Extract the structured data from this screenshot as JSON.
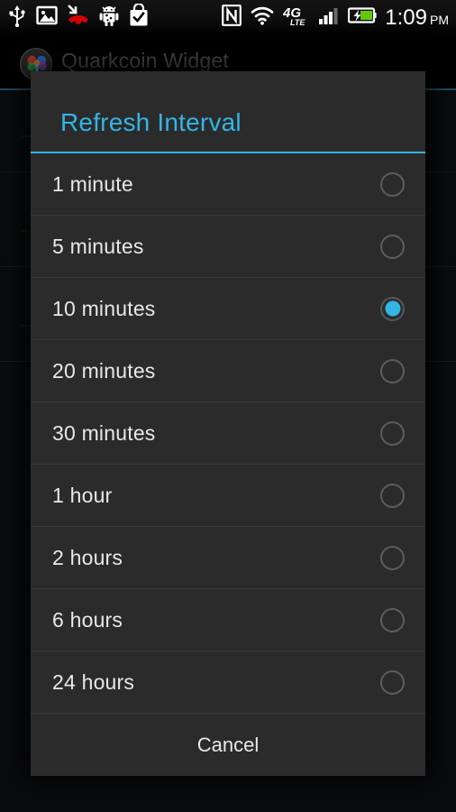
{
  "status_bar": {
    "time": "1:09",
    "am_pm": "PM",
    "left_icons": [
      {
        "name": "usb-icon",
        "label": "USB connected"
      },
      {
        "name": "screenshot-image-icon",
        "label": "Screenshot captured"
      },
      {
        "name": "missed-call-icon",
        "label": "Missed call"
      },
      {
        "name": "android-debug-icon",
        "label": "USB debugging connected"
      },
      {
        "name": "play-store-bag-check-icon",
        "label": "App installed"
      }
    ],
    "right_icons": [
      {
        "name": "nfc-icon",
        "label": "NFC enabled"
      },
      {
        "name": "wifi-icon",
        "label": "Wi-Fi signal"
      },
      {
        "name": "network-4glte-icon",
        "label": "4G LTE"
      },
      {
        "name": "cellular-signal-icon",
        "label": "Cellular signal"
      },
      {
        "name": "battery-charging-icon",
        "label": "Battery charging"
      }
    ],
    "network_label_primary": "4G",
    "network_label_secondary": "LTE"
  },
  "action_bar": {
    "title": "Quarkcoin Widget",
    "icon": "quarkcoin-app-icon"
  },
  "dialog": {
    "title": "Refresh Interval",
    "accent_color": "#33b5e5",
    "background_color": "#2b2b2b",
    "cancel_label": "Cancel",
    "selected_value": "10 minutes",
    "options": [
      {
        "label": "1 minute",
        "selected": false
      },
      {
        "label": "5 minutes",
        "selected": false
      },
      {
        "label": "10 minutes",
        "selected": true
      },
      {
        "label": "20 minutes",
        "selected": false
      },
      {
        "label": "30 minutes",
        "selected": false
      },
      {
        "label": "1 hour",
        "selected": false
      },
      {
        "label": "2 hours",
        "selected": false
      },
      {
        "label": "6 hours",
        "selected": false
      },
      {
        "label": "24 hours",
        "selected": false
      }
    ]
  }
}
